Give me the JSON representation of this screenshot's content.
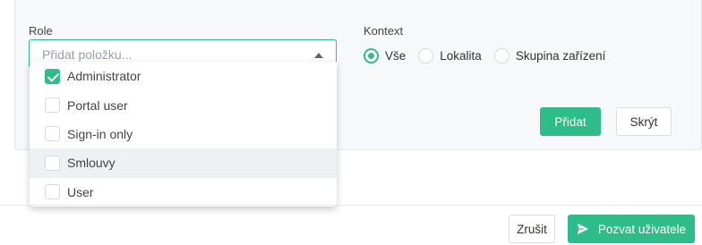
{
  "form": {
    "role_label": "Role",
    "role_placeholder": "Přidat položku...",
    "context_label": "Kontext",
    "context_options": [
      {
        "label": "Vše",
        "checked": true
      },
      {
        "label": "Lokalita",
        "checked": false
      },
      {
        "label": "Skupina zařízení",
        "checked": false
      }
    ],
    "add_label": "Přidat",
    "hide_label": "Skrýt"
  },
  "dropdown": {
    "options": [
      {
        "label": "Administrator",
        "checked": true
      },
      {
        "label": "Portal user",
        "checked": false
      },
      {
        "label": "Sign-in only",
        "checked": false
      },
      {
        "label": "Smlouvy",
        "checked": false
      },
      {
        "label": "User",
        "checked": false
      }
    ]
  },
  "footer": {
    "cancel_label": "Zrušit",
    "invite_label": "Pozvat uživatele"
  },
  "colors": {
    "accent": "#2ebd8a"
  },
  "icons": {
    "caret": "caret-up-icon",
    "send": "send-icon"
  }
}
